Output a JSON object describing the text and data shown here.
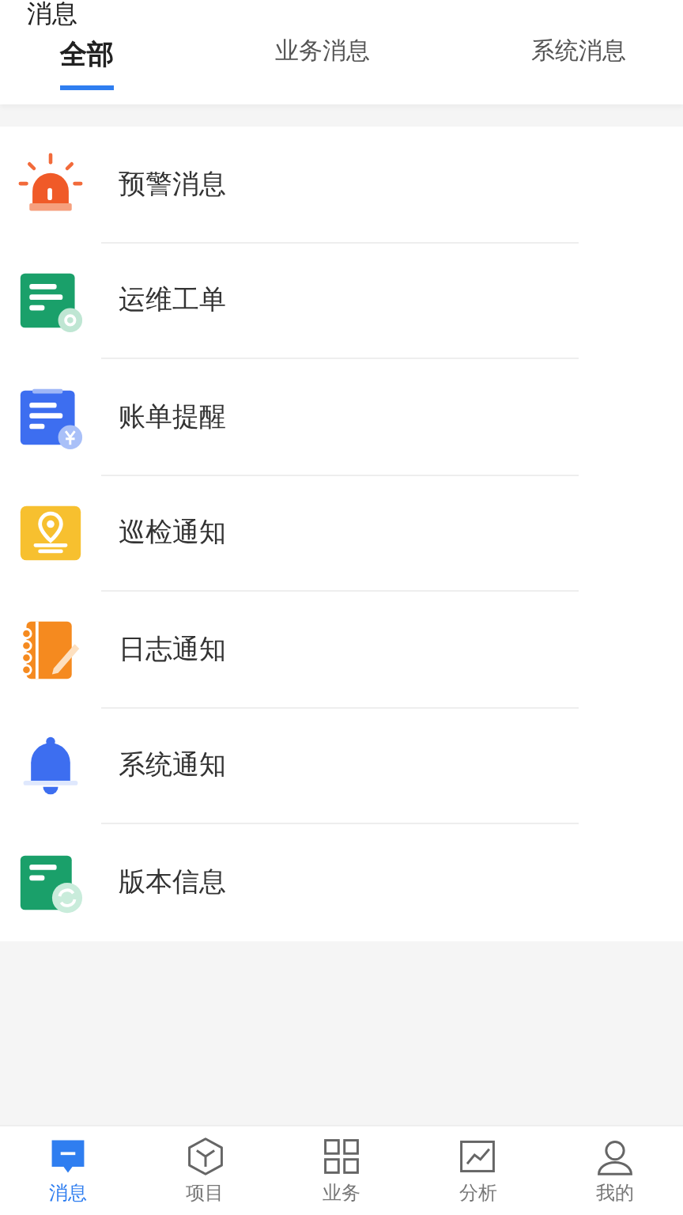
{
  "header": {
    "title": "消息"
  },
  "tabs": [
    {
      "label": "全部",
      "selected": true
    },
    {
      "label": "业务消息",
      "selected": false
    },
    {
      "label": "系统消息",
      "selected": false
    }
  ],
  "messages": [
    {
      "kind": "alarm",
      "label": "预警消息"
    },
    {
      "kind": "workorder",
      "label": "运维工单"
    },
    {
      "kind": "bill",
      "label": "账单提醒"
    },
    {
      "kind": "patrol",
      "label": "巡检通知"
    },
    {
      "kind": "log",
      "label": "日志通知"
    },
    {
      "kind": "bell",
      "label": "系统通知"
    },
    {
      "kind": "version",
      "label": "版本信息"
    }
  ],
  "bottom_nav": [
    {
      "kind": "message",
      "label": "消息",
      "selected": true
    },
    {
      "kind": "project",
      "label": "项目",
      "selected": false
    },
    {
      "kind": "business",
      "label": "业务",
      "selected": false
    },
    {
      "kind": "analysis",
      "label": "分析",
      "selected": false
    },
    {
      "kind": "profile",
      "label": "我的",
      "selected": false
    }
  ]
}
